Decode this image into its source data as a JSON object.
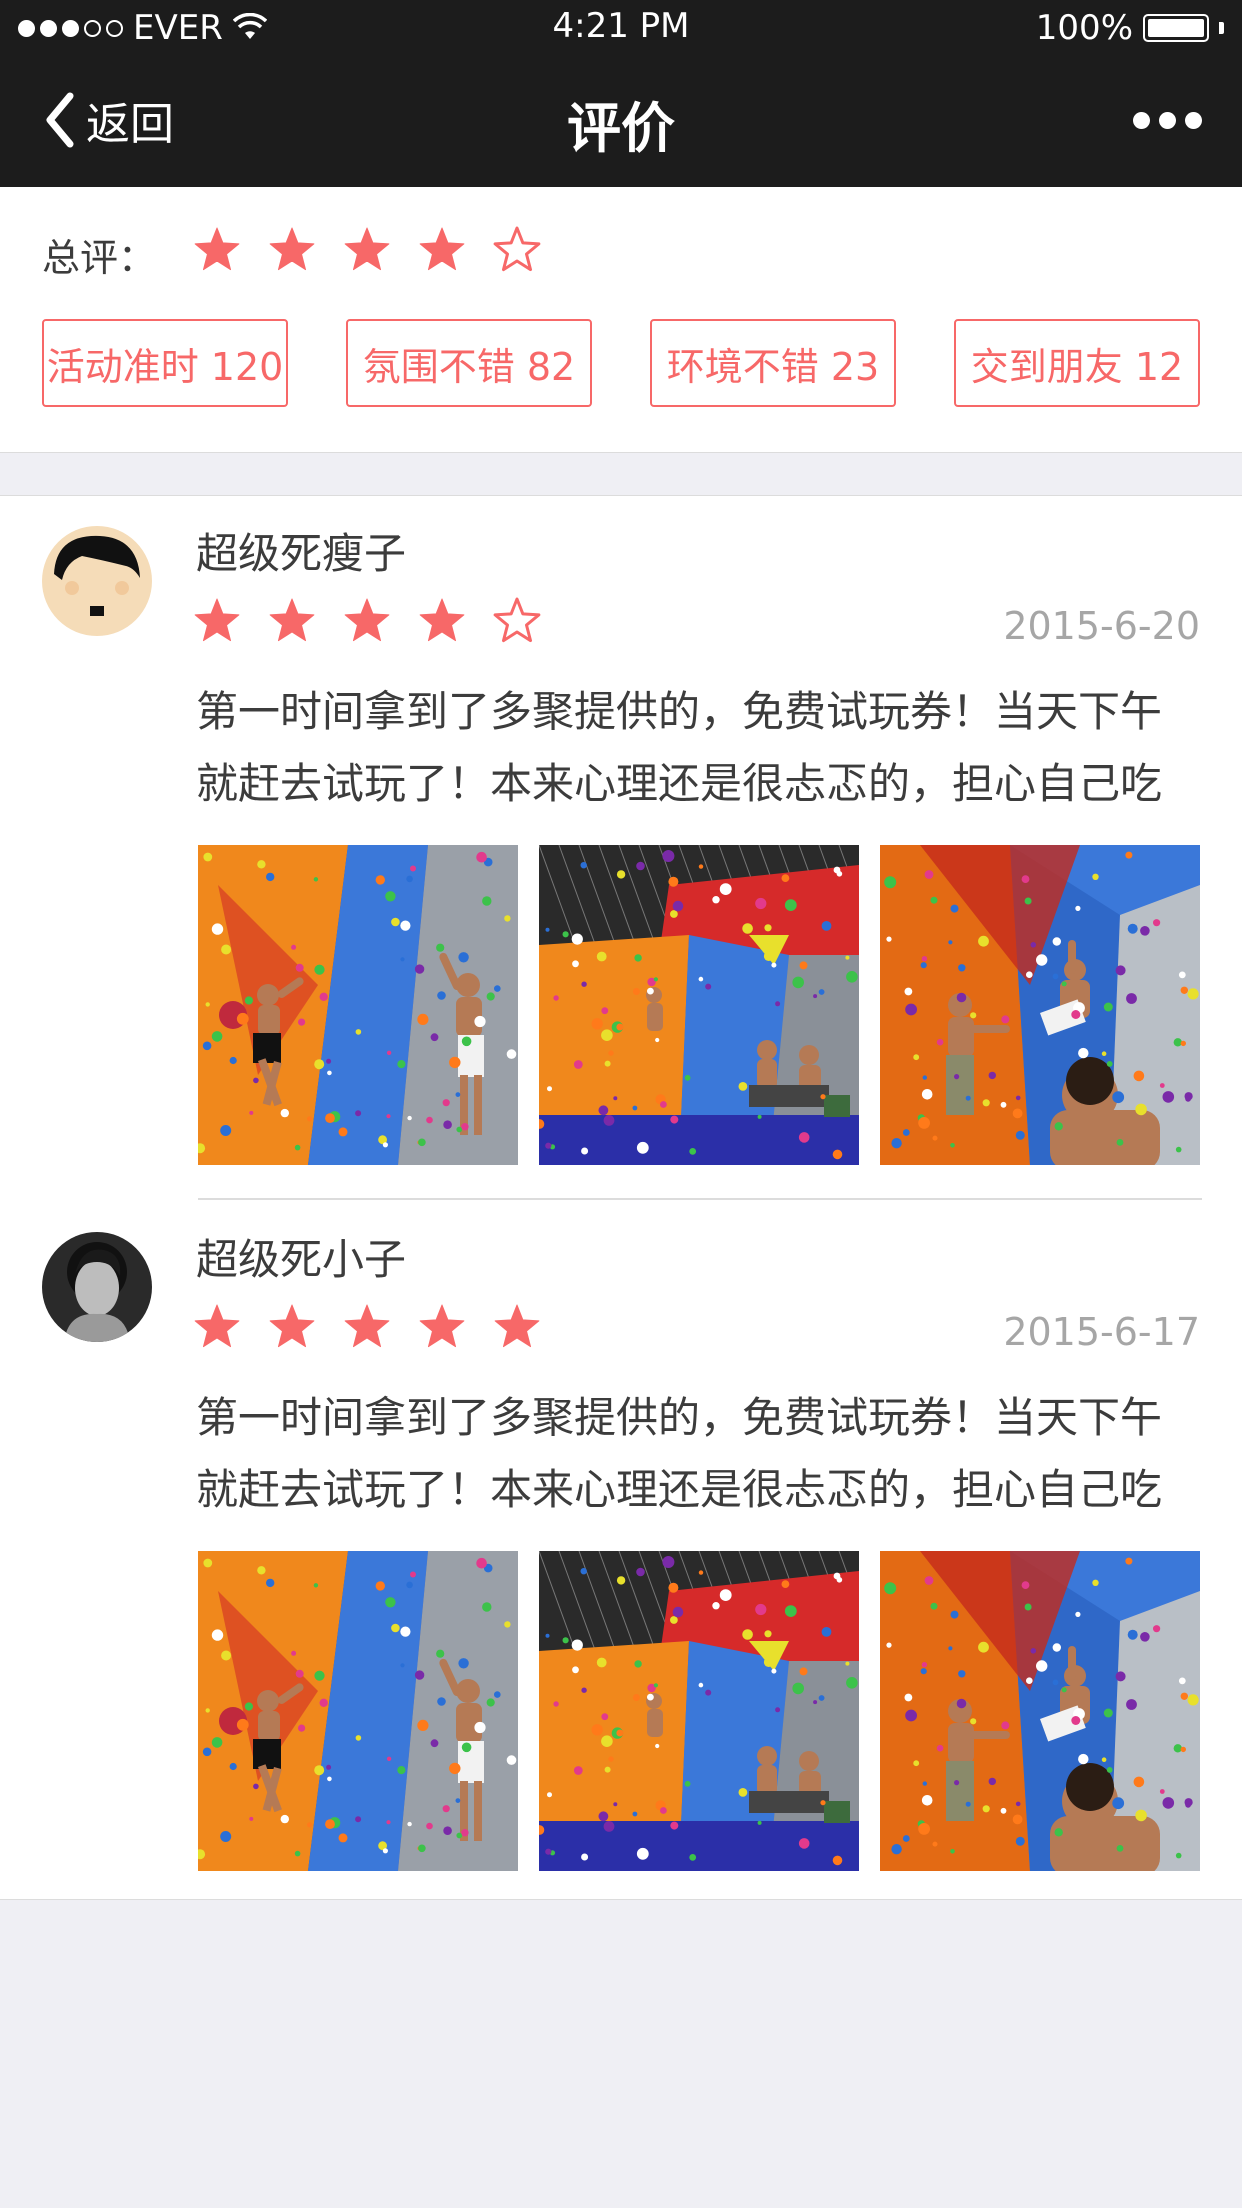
{
  "status_bar": {
    "carrier": "EVER",
    "time": "4:21 PM",
    "battery": "100%",
    "signal_bars": 3
  },
  "nav": {
    "back_label": "返回",
    "title": "评价",
    "more_icon": "more-dots-icon"
  },
  "summary": {
    "label": "总评：",
    "rating": 4,
    "max_rating": 5,
    "tags": [
      {
        "text": "活动准时 120"
      },
      {
        "text": "氛围不错 82"
      },
      {
        "text": "环境不错 23"
      },
      {
        "text": "交到朋友 12"
      }
    ]
  },
  "reviews": [
    {
      "user": "超级死瘦子",
      "rating": 4,
      "date": "2015-6-20",
      "text": "第一时间拿到了多聚提供的，免费试玩券！当天下午就赶去试玩了！本来心理还是很忐忑的，担心自己吃不...",
      "photo_count": 3
    },
    {
      "user": "超级死小子",
      "rating": 5,
      "date": "2015-6-17",
      "text": "第一时间拿到了多聚提供的，免费试玩券！当天下午就赶去试玩了！本来心理还是很忐忑的，担心自己吃不...",
      "photo_count": 3
    }
  ],
  "colors": {
    "accent": "#f76868",
    "text": "#3c3c3c",
    "muted": "#a6a6a6",
    "bar": "#1c1c1c",
    "background": "#efeff4"
  }
}
